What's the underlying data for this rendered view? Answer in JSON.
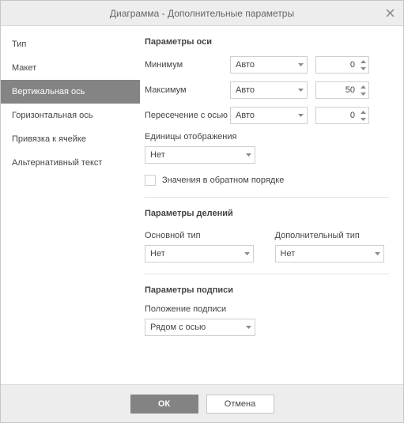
{
  "title": "Диаграмма - Дополнительные параметры",
  "sidebar": {
    "items": [
      {
        "label": "Тип"
      },
      {
        "label": "Макет"
      },
      {
        "label": "Вертикальная ось"
      },
      {
        "label": "Горизонтальная ось"
      },
      {
        "label": "Привязка к ячейке"
      },
      {
        "label": "Альтернативный текст"
      }
    ],
    "active_index": 2
  },
  "axis": {
    "section_title": "Параметры оси",
    "min_label": "Минимум",
    "min_mode": "Авто",
    "min_value": "0",
    "max_label": "Максимум",
    "max_mode": "Авто",
    "max_value": "50",
    "cross_label": "Пересечение с осью",
    "cross_mode": "Авто",
    "cross_value": "0",
    "units_label": "Единицы отображения",
    "units_value": "Нет",
    "reverse_label": "Значения в обратном порядке"
  },
  "ticks": {
    "section_title": "Параметры делений",
    "major_label": "Основной тип",
    "major_value": "Нет",
    "minor_label": "Дополнительный тип",
    "minor_value": "Нет"
  },
  "labels": {
    "section_title": "Параметры подписи",
    "pos_label": "Положение подписи",
    "pos_value": "Рядом с осью"
  },
  "buttons": {
    "ok": "ОК",
    "cancel": "Отмена"
  }
}
